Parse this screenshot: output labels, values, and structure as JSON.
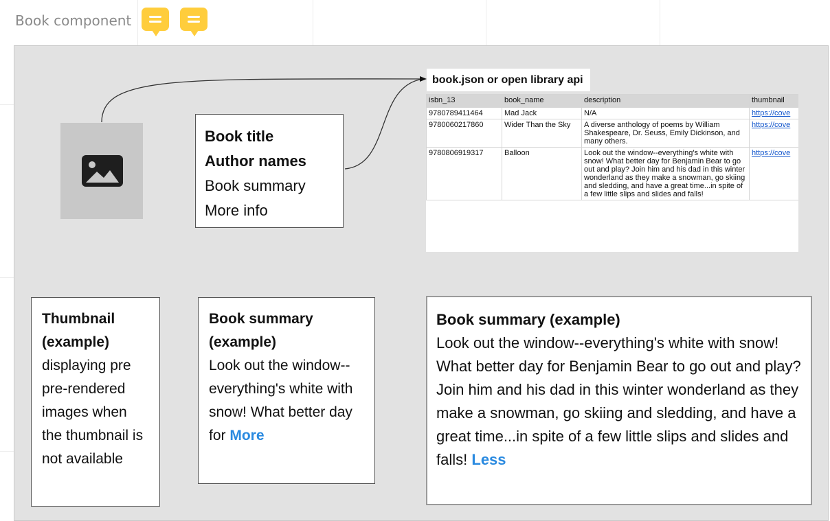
{
  "canvas": {
    "title": "Book component",
    "comment_icons": [
      "comment-icon",
      "comment-icon"
    ]
  },
  "placeholder": {
    "icon": "image-icon"
  },
  "info_box": {
    "title": "Book title",
    "authors": "Author names",
    "summary": "Book summary",
    "more": "More info"
  },
  "api": {
    "title": "book.json or open library api",
    "columns": [
      "isbn_13",
      "book_name",
      "description",
      "thumbnail"
    ],
    "rows": [
      {
        "isbn_13": "9780789411464",
        "book_name": "Mad Jack",
        "description": "N/A",
        "thumbnail": "https://cove"
      },
      {
        "isbn_13": "9780060217860",
        "book_name": "Wider Than the Sky",
        "description": "A diverse anthology of poems by William Shakespeare, Dr. Seuss, Emily Dickinson, and many others.",
        "thumbnail": "https://cove"
      },
      {
        "isbn_13": "9780806919317",
        "book_name": "Balloon",
        "description": "Look out the window--everything's white with snow! What better day for Benjamin Bear to go out and play? Join him and his dad in this winter wonderland as they make a snowman, go skiing and sledding, and have a great time...in spite of a few little slips and slides and falls!",
        "thumbnail": "https://cove"
      }
    ]
  },
  "thumbnail_card": {
    "title": "Thumbnail (example)",
    "body": "displaying pre pre-rendered images when the thumbnail is not available"
  },
  "summary_card": {
    "title": "Book summary (example)",
    "body": "Look out the window--everything's white with snow! What better day for",
    "link": "More"
  },
  "summary_expanded": {
    "title": "Book summary (example)",
    "body": "Look out the window--everything's white with snow! What better day for Benjamin Bear to go out and play? Join him and his dad in this winter wonderland as they make a snowman, go skiing and sledding, and have a great time...in spite of a few little slips and slides and falls!",
    "link": "Less"
  },
  "colors": {
    "comment": "#ffcd3c",
    "frame": "#e2e2e2",
    "link": "#2a8ae0",
    "sheet_link": "#1155cc"
  }
}
